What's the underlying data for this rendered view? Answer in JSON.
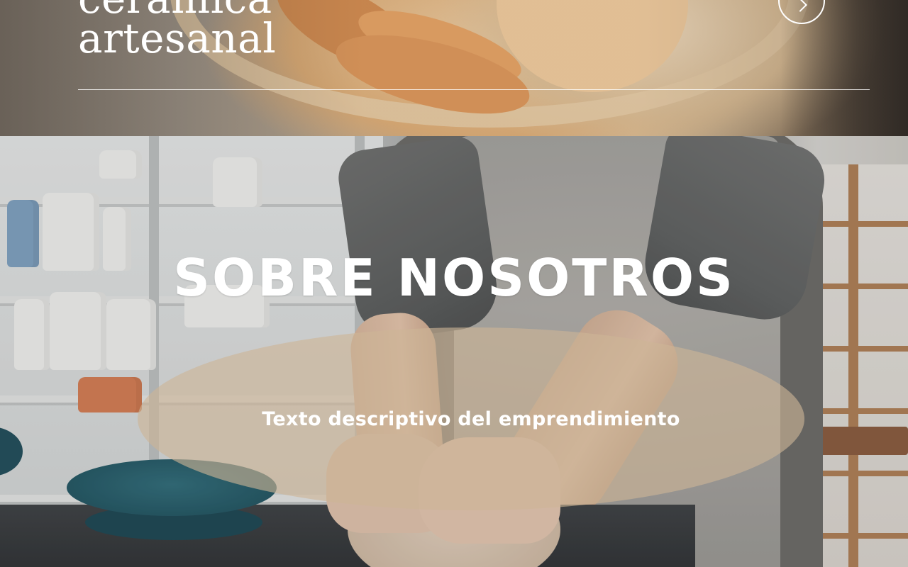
{
  "hero": {
    "title_line1": "cerámica",
    "title_line2": "artesanal",
    "next_button_label": "Siguiente"
  },
  "about": {
    "title": "SOBRE NOSOTROS",
    "description": "Texto descriptivo del emprendimiento"
  },
  "icons": {
    "next": "chevron-right-icon"
  },
  "colors": {
    "text": "#ffffff",
    "pill_background": "#cdb496"
  }
}
